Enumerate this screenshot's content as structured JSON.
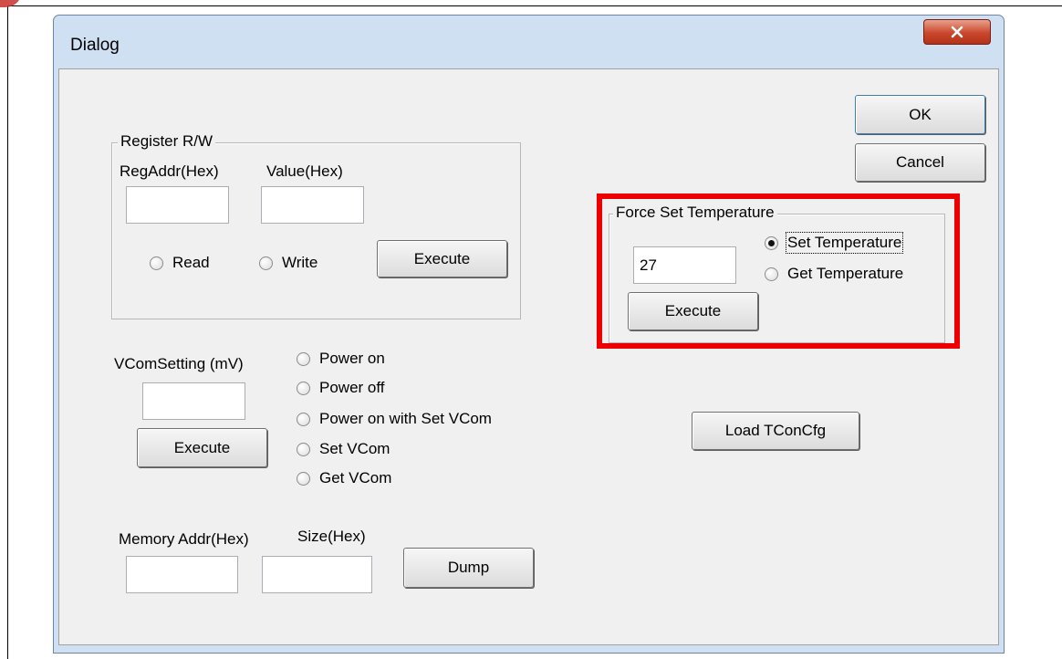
{
  "dialog": {
    "title": "Dialog",
    "ok_label": "OK",
    "cancel_label": "Cancel"
  },
  "register": {
    "group_title": "Register R/W",
    "reg_addr_label": "RegAddr(Hex)",
    "value_label": "Value(Hex)",
    "reg_addr_value": "",
    "value_value": "",
    "read_label": "Read",
    "write_label": "Write",
    "execute_label": "Execute"
  },
  "vcom": {
    "setting_label": "VComSetting (mV)",
    "setting_value": "",
    "execute_label": "Execute",
    "options": [
      "Power on",
      "Power off",
      "Power on with Set VCom",
      "Set VCom",
      "Get VCom"
    ]
  },
  "memory": {
    "addr_label": "Memory Addr(Hex)",
    "size_label": "Size(Hex)",
    "addr_value": "",
    "size_value": "",
    "dump_label": "Dump"
  },
  "temperature": {
    "group_title": "Force Set Temperature",
    "value": "27",
    "set_label": "Set Temperature",
    "get_label": "Get Temperature",
    "selected": "Set Temperature",
    "execute_label": "Execute"
  },
  "load_tcon_label": "Load TConCfg",
  "icons": {
    "close": "close-icon",
    "radio": "radio-button-icon"
  },
  "colors": {
    "highlight": "#ee0000",
    "close_button": "#c9472c",
    "window_frame": "#cfe0f3",
    "client_background": "#f0f0f0"
  }
}
